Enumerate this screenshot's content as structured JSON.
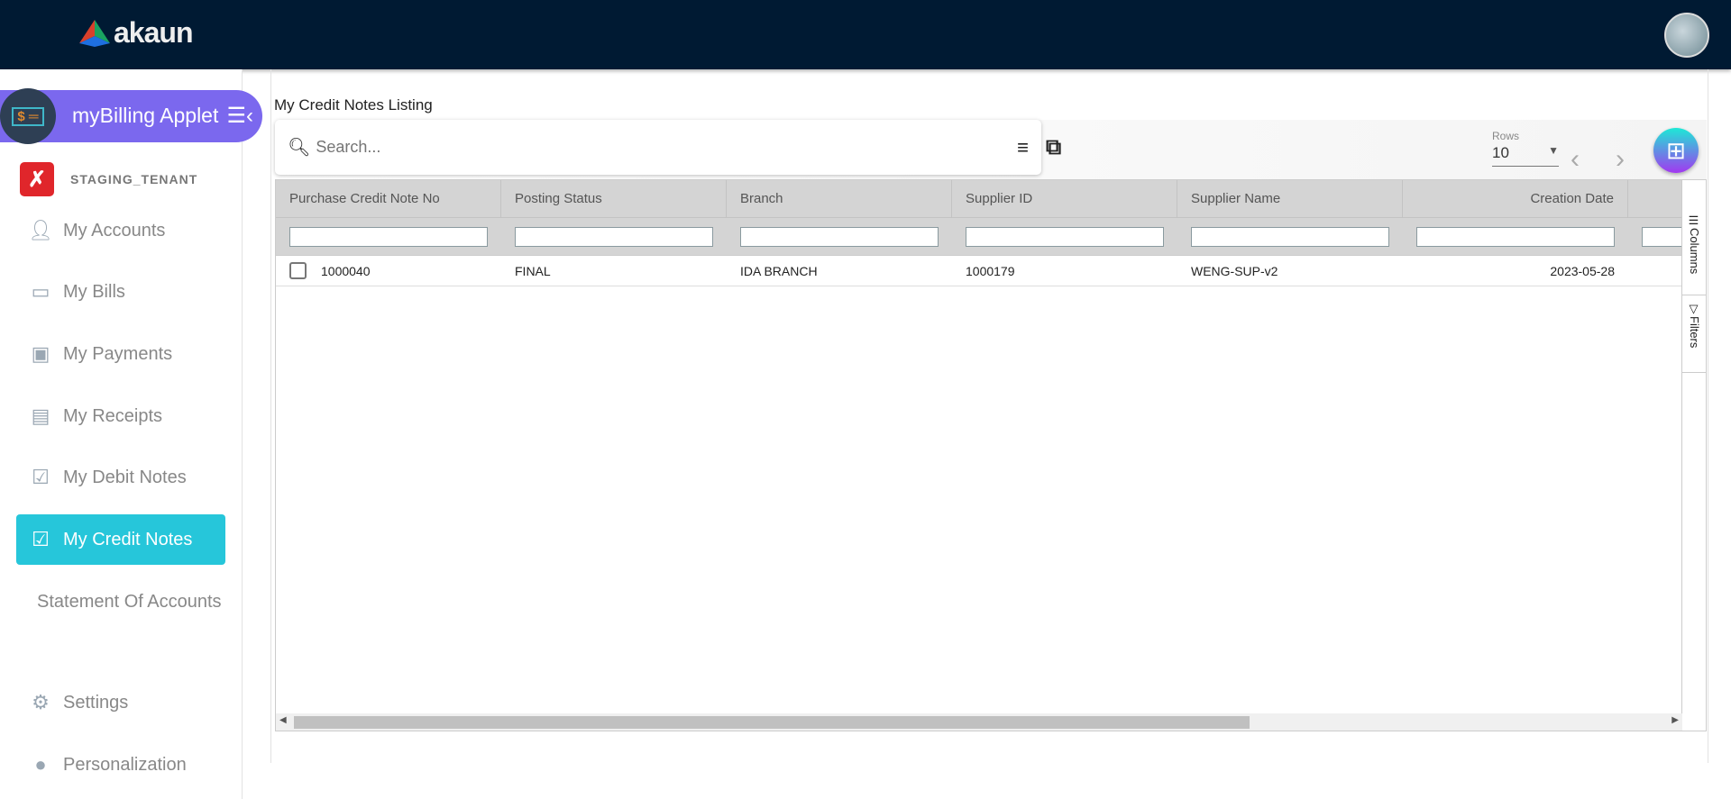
{
  "header": {
    "brand": "akaun"
  },
  "sidebar": {
    "applet_title": "myBilling Applet",
    "tenant": "STAGING_TENANT",
    "items": [
      {
        "label": "My Accounts"
      },
      {
        "label": "My Bills"
      },
      {
        "label": "My Payments"
      },
      {
        "label": "My Receipts"
      },
      {
        "label": "My Debit Notes"
      },
      {
        "label": "My Credit Notes"
      },
      {
        "label": "Statement Of Accounts"
      },
      {
        "label": "Settings"
      },
      {
        "label": "Personalization"
      }
    ]
  },
  "main": {
    "title": "My Credit Notes Listing",
    "search_placeholder": "Search...",
    "rows_label": "Rows",
    "rows_value": "10",
    "columns": [
      "Purchase Credit Note No",
      "Posting Status",
      "Branch",
      "Supplier ID",
      "Supplier Name",
      "Creation Date"
    ],
    "rows": [
      [
        "1000040",
        "FINAL",
        "IDA BRANCH",
        "1000179",
        "WENG-SUP-v2",
        "2023-05-28"
      ]
    ],
    "side_tabs": {
      "columns": "Columns",
      "filters": "Filters"
    }
  },
  "colors": {
    "topbar": "#001a33",
    "applet": "#7b68ee",
    "active": "#26c6da"
  }
}
